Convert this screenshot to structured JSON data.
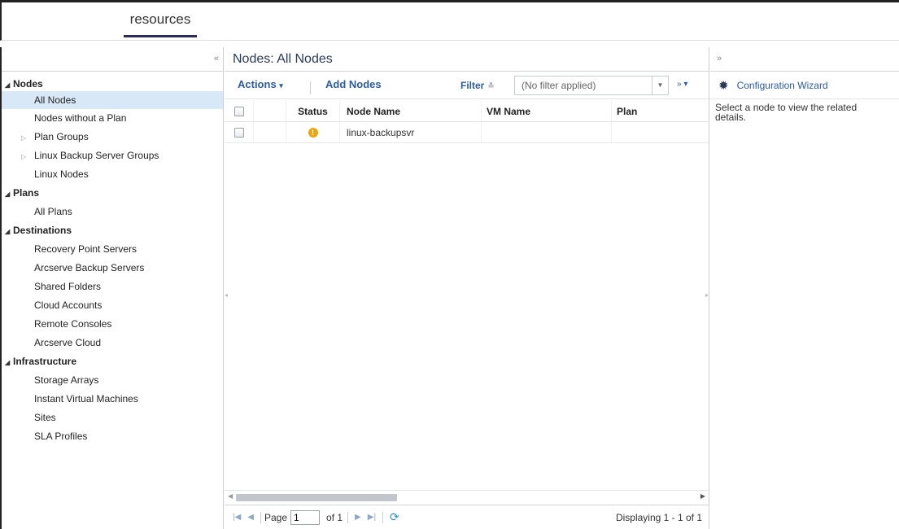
{
  "top": {
    "tab_label": "resources"
  },
  "sidebar": {
    "collapse_glyph": "«",
    "groups": [
      {
        "label": "Nodes",
        "items": [
          {
            "label": "All Nodes",
            "selected": true
          },
          {
            "label": "Nodes without a Plan"
          },
          {
            "label": "Plan Groups",
            "expandable": true
          },
          {
            "label": "Linux Backup Server Groups",
            "expandable": true
          },
          {
            "label": "Linux Nodes"
          }
        ]
      },
      {
        "label": "Plans",
        "items": [
          {
            "label": "All Plans"
          }
        ]
      },
      {
        "label": "Destinations",
        "items": [
          {
            "label": "Recovery Point Servers"
          },
          {
            "label": "Arcserve Backup Servers"
          },
          {
            "label": "Shared Folders"
          },
          {
            "label": "Cloud Accounts"
          },
          {
            "label": "Remote Consoles"
          },
          {
            "label": "Arcserve Cloud"
          }
        ]
      },
      {
        "label": "Infrastructure",
        "items": [
          {
            "label": "Storage Arrays"
          },
          {
            "label": "Instant Virtual Machines"
          },
          {
            "label": "Sites"
          },
          {
            "label": "SLA Profiles"
          }
        ]
      }
    ]
  },
  "center": {
    "title": "Nodes: All Nodes",
    "toolbar": {
      "actions_label": "Actions",
      "add_nodes_label": "Add Nodes",
      "filter_label": "Filter",
      "filter_value": "(No filter applied)"
    },
    "grid": {
      "columns": {
        "status": "Status",
        "node_name": "Node Name",
        "vm_name": "VM Name",
        "plan": "Plan"
      },
      "rows": [
        {
          "status": "warning",
          "node_name": "linux-backupsvr",
          "vm_name": "",
          "plan": ""
        }
      ]
    },
    "pager": {
      "page_label": "Page",
      "page_value": "1",
      "of_label": "of 1",
      "display_text": "Displaying 1 - 1 of 1"
    }
  },
  "right": {
    "collapse_glyph": "»",
    "wizard_label": "Configuration Wizard",
    "message": "Select a node to view the related details."
  },
  "colors": {
    "accent": "#2a5ba8",
    "selected_bg": "#d9e8f7",
    "warning": "#f0a30a"
  }
}
